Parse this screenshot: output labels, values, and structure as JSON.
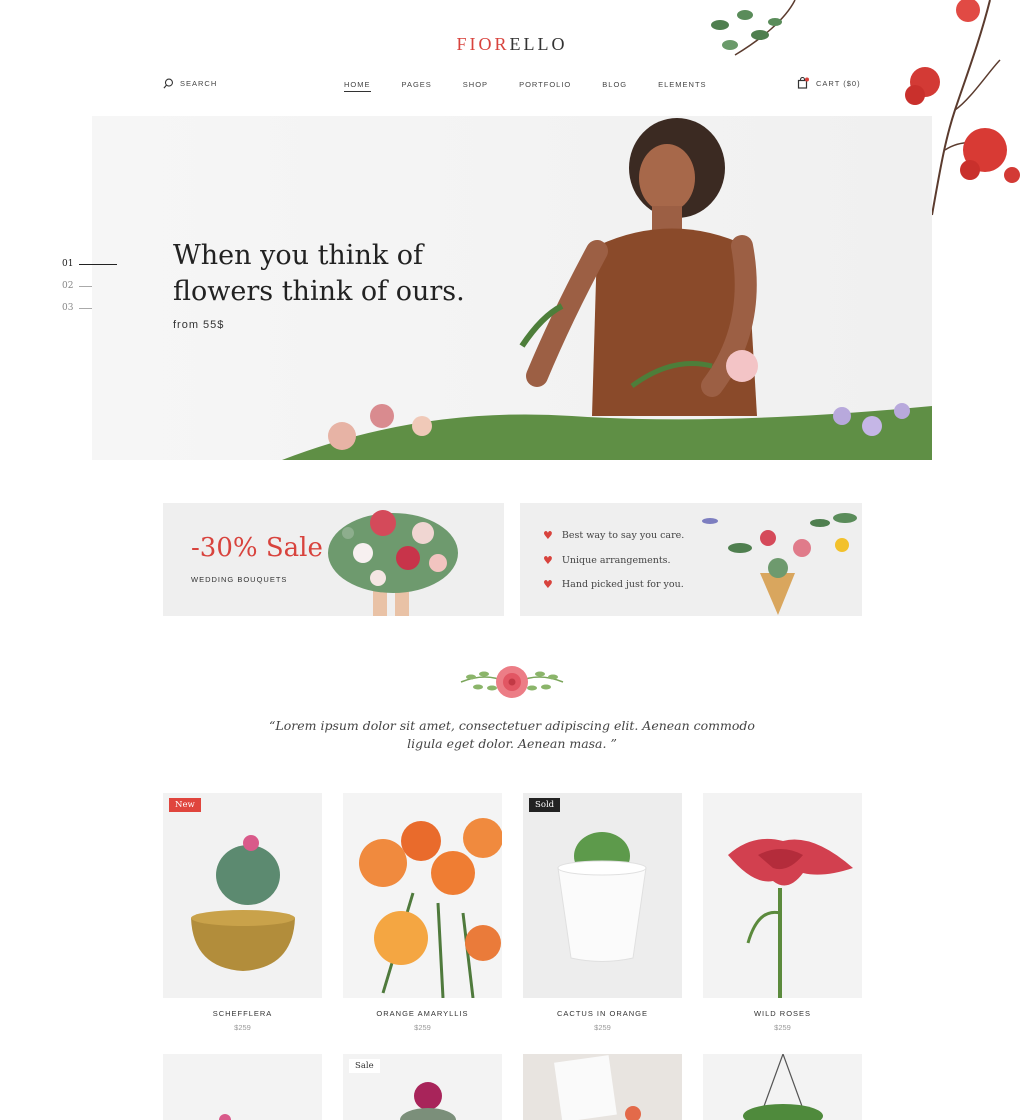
{
  "logo": {
    "accent": "FIOR",
    "rest": "ELLO"
  },
  "search": {
    "label": "SEARCH"
  },
  "nav": [
    {
      "label": "HOME"
    },
    {
      "label": "PAGES"
    },
    {
      "label": "SHOP"
    },
    {
      "label": "PORTFOLIO"
    },
    {
      "label": "BLOG"
    },
    {
      "label": "ELEMENTS"
    }
  ],
  "cart": {
    "label": "CART ($0)"
  },
  "hero": {
    "title_line1": "When you think of",
    "title_line2": "flowers think of ours.",
    "subtitle": "from 55$"
  },
  "slides": [
    "01",
    "02",
    "03"
  ],
  "promo": {
    "sale_title": "-30% Sale",
    "sale_subtitle": "WEDDING BOUQUETS",
    "features": [
      "Best way to say you care.",
      "Unique arrangements.",
      "Hand picked just for you."
    ]
  },
  "quote": "“Lorem ipsum dolor sit amet, consectetuer adipiscing elit. Aenean commodo ligula eget dolor. Aenean masa. ”",
  "products": [
    {
      "name": "SCHEFFLERA",
      "price": "$259",
      "badge": "New"
    },
    {
      "name": "ORANGE AMARYLLIS",
      "price": "$259",
      "badge": ""
    },
    {
      "name": "CACTUS IN ORANGE",
      "price": "$259",
      "badge": "Sold"
    },
    {
      "name": "WILD ROSES",
      "price": "$259",
      "badge": ""
    }
  ],
  "products_row2": [
    {
      "badge": ""
    },
    {
      "badge": "Sale"
    },
    {
      "badge": ""
    },
    {
      "badge": ""
    }
  ],
  "colors": {
    "accent": "#d8433d",
    "text": "#222222",
    "muted": "#999999"
  }
}
